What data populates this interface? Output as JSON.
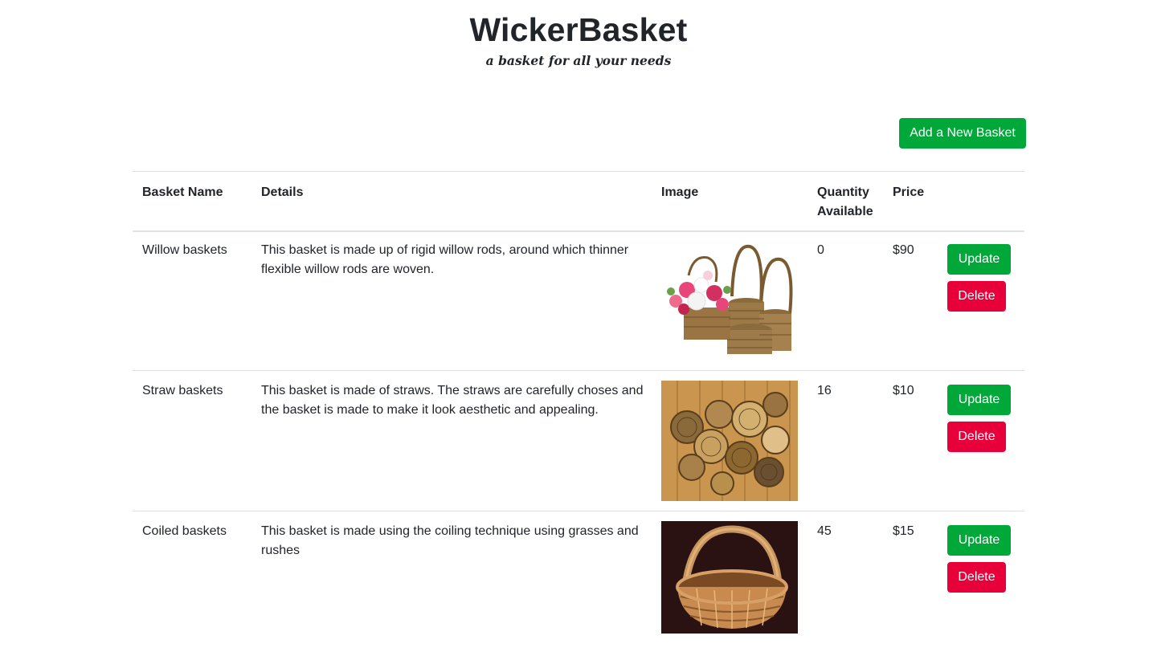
{
  "header": {
    "title": "WickerBasket",
    "tagline": "a basket for all your needs"
  },
  "actions": {
    "add_label": "Add a New Basket"
  },
  "table": {
    "columns": [
      "Basket Name",
      "Details",
      "Image",
      "Quantity Available",
      "Price"
    ],
    "rows": [
      {
        "name": "Willow baskets",
        "details": "This basket is made up of rigid willow rods, around which thinner flexible willow rods are woven.",
        "image": "willow-baskets-with-flowers",
        "quantity": "0",
        "price": "$90",
        "update_label": "Update",
        "delete_label": "Delete"
      },
      {
        "name": "Straw baskets",
        "details": "This basket is made of straws. The straws are carefully choses and the basket is made to make it look aesthetic and appealing.",
        "image": "straw-baskets-on-wood-wall",
        "quantity": "16",
        "price": "$10",
        "update_label": "Update",
        "delete_label": "Delete"
      },
      {
        "name": "Coiled baskets",
        "details": "This basket is made using the coiling technique using grasses and rushes",
        "image": "coiled-basket-with-handle",
        "quantity": "45",
        "price": "$15",
        "update_label": "Update",
        "delete_label": "Delete"
      }
    ]
  },
  "colors": {
    "success": "#00a83a",
    "danger": "#e8003a",
    "text": "#212529",
    "border": "#dee2e6"
  }
}
